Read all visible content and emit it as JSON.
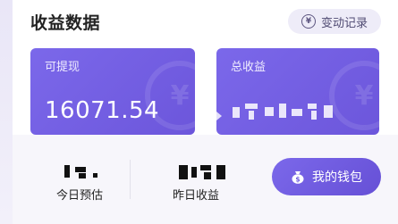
{
  "header": {
    "title": "收益数据",
    "record_button": {
      "label": "变动记录",
      "icon": "yen-circle-icon"
    }
  },
  "cards": [
    {
      "label": "可提现",
      "amount": "16071.54"
    },
    {
      "label": "总收益",
      "amount": ""
    }
  ],
  "stats": [
    {
      "label": "今日预估",
      "value": ""
    },
    {
      "label": "昨日收益",
      "value": ""
    }
  ],
  "wallet_button": {
    "label": "我的钱包",
    "icon": "money-bag-icon"
  },
  "colors": {
    "accent": "#7164e3",
    "card_bg": "#7466e4",
    "record_btn_bg": "#eeecf8"
  }
}
